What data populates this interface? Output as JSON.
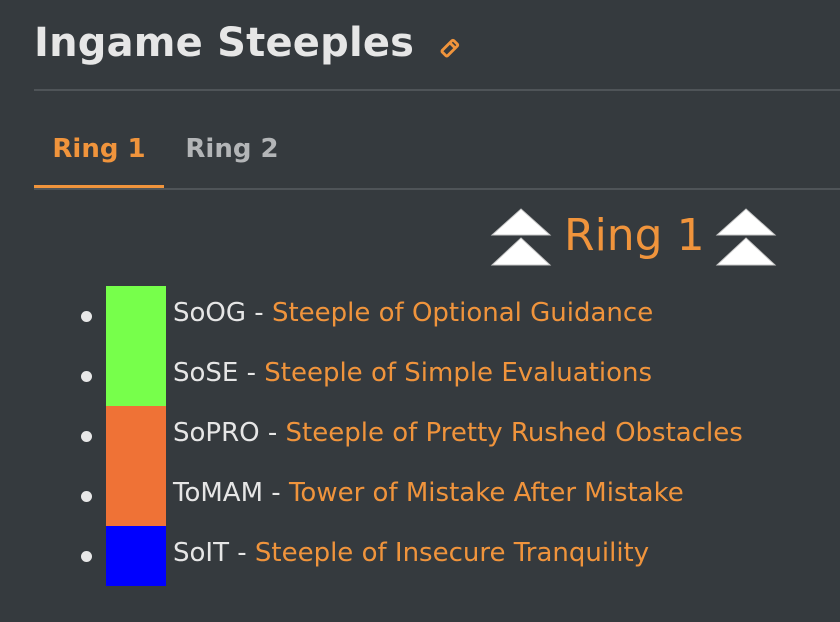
{
  "header": {
    "title": "Ingame Steeples",
    "edit_icon": "pencil-icon"
  },
  "tabs": [
    {
      "label": "Ring 1",
      "active": true
    },
    {
      "label": "Ring 2",
      "active": false
    }
  ],
  "ring": {
    "title": "Ring 1",
    "icon": "double-chevron-up-icon"
  },
  "steeples": [
    {
      "abbr": "SoOG",
      "separator": " - ",
      "name": "Steeple of Optional Guidance",
      "color": "#77ff4b"
    },
    {
      "abbr": "SoSE",
      "separator": " - ",
      "name": "Steeple of Simple Evaluations",
      "color": "#77ff4b"
    },
    {
      "abbr": "SoPRO",
      "separator": " - ",
      "name": "Steeple of Pretty Rushed Obstacles",
      "color": "#ef7236"
    },
    {
      "abbr": "ToMAM",
      "separator": " - ",
      "name": "Tower of Mistake After Mistake",
      "color": "#ef7236"
    },
    {
      "abbr": "SoIT",
      "separator": " - ",
      "name": "Steeple of Insecure Tranquility",
      "color": "#0000ff"
    }
  ],
  "colors": {
    "accent": "#f0943c",
    "background": "#353a3e",
    "text": "#e6e6e6"
  }
}
